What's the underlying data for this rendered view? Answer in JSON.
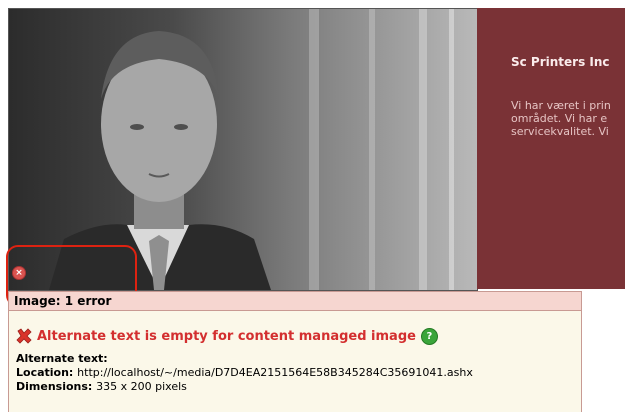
{
  "banner": {
    "company": "Sc Printers Inc",
    "paragraph_lines": [
      "Vi har været i prin",
      "området. Vi har e",
      "servicekvalitet. Vi"
    ]
  },
  "error_header": "Image: 1 error",
  "error_item": {
    "message": "Alternate text is empty for content managed image",
    "alt_label": "Alternate text:",
    "alt_value": "",
    "location_label": "Location:",
    "location_value": "http://localhost/~/media/D7D4EA2151564E58B345284C35691041.ashx",
    "dimensions_label": "Dimensions:",
    "dimensions_value": "335 x 200 pixels"
  },
  "icons": {
    "error_small": "error-icon",
    "error_x": "red-x-icon",
    "help": "help-icon"
  },
  "colors": {
    "banner_bg": "#7a3236",
    "error_text": "#d32f2f",
    "header_bg": "#f6d6d0",
    "panel_bg": "#fbf8e9",
    "highlight": "#dd2211"
  }
}
